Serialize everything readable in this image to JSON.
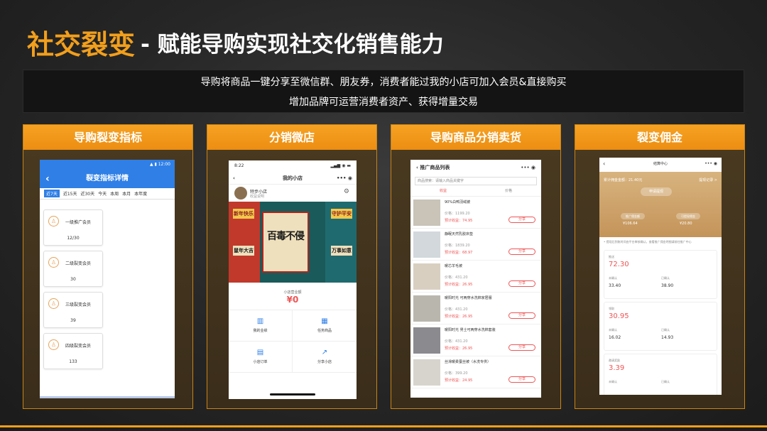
{
  "title": {
    "highlight": "社交裂变",
    "rest": "- 赋能导购实现社交化销售能力"
  },
  "description": {
    "line1": "导购将商品一键分享至微信群、朋友券，消费者能过我的小店可加入会员&直接购买",
    "line2": "增加品牌可运营消费者资产、获得增量交易"
  },
  "panels": [
    {
      "header": "导购裂变指标"
    },
    {
      "header": "分销微店"
    },
    {
      "header": "导购商品分销卖货"
    },
    {
      "header": "裂变佣金"
    }
  ],
  "phone1": {
    "status_time": "12:00",
    "page_title": "裂变指标详情",
    "tabs": [
      "近7天",
      "近15天",
      "近30天",
      "今天",
      "本周",
      "本月",
      "本年度"
    ],
    "cards": [
      {
        "label": "一级推广会员",
        "value": "12/30"
      },
      {
        "label": "二级裂变会员",
        "value": "30"
      },
      {
        "label": "三级裂变会员",
        "value": "39"
      },
      {
        "label": "四级裂变会员",
        "value": "133"
      }
    ]
  },
  "phone2": {
    "status_time": "8:22",
    "page_title": "我的小店",
    "shop_name": "特步小店",
    "shop_sub": "收益说明",
    "banner_main": "百毒不侵",
    "banner_tags": [
      "新年快乐",
      "鼠年大吉",
      "守护平安",
      "万事如意"
    ],
    "balance_label": "小店营业额",
    "balance_value": "¥0",
    "grid": [
      {
        "label": "我的业绩",
        "icon": "chart-icon"
      },
      {
        "label": "任务商品",
        "icon": "goods-icon"
      },
      {
        "label": "小店订单",
        "icon": "order-icon"
      },
      {
        "label": "分享小店",
        "icon": "share-icon"
      }
    ]
  },
  "phone3": {
    "page_title": "推广商品列表",
    "search_placeholder": "商品搜索：请输入商品关键字",
    "tabs": [
      "收益",
      "价格"
    ],
    "share_label": "分享",
    "items": [
      {
        "name": "90%白鸭羽绒被",
        "price": "价格：1199.20",
        "earn": "预计收益：74.95",
        "color": "#c9c3b8"
      },
      {
        "name": "静眠天然乳胶床垫",
        "price": "价格：1839.20",
        "earn": "预计收益：68.97",
        "color": "#d2d8dc"
      },
      {
        "name": "暖芯羊毛被",
        "price": "价格：431.20",
        "earn": "预计收益：26.95",
        "color": "#d9cfc0"
      },
      {
        "name": "暖阳时光 可两穿水洗棉家居服",
        "price": "价格：431.20",
        "earn": "预计收益：26.95",
        "color": "#b9b6ae"
      },
      {
        "name": "暖阳时光 男士可两穿水洗棉套装",
        "price": "价格：431.20",
        "earn": "预计收益：26.95",
        "color": "#8a8a8f"
      },
      {
        "name": "丝滑暖柔蚕丝被（水洗专供）",
        "price": "价格：399.20",
        "earn": "预计收益：24.95",
        "color": "#d6d4cc"
      }
    ]
  },
  "phone4": {
    "page_title": "结算中心",
    "total_label": "累计佣金金额：21.40元",
    "record_label": "提现记录 >",
    "withdraw_btn": "申请提现",
    "pill1": "推广佣金额",
    "pill2": "可提现佣金",
    "val1": "¥106.64",
    "val2": "¥20.80",
    "note": "• 提现后到账时间由平台审核确认，查看推广佣金明细请前往推广中心",
    "cards": [
      {
        "caption": "推送",
        "big": "72.30",
        "c1": "未确认",
        "c2": "已确认",
        "v1": "33.40",
        "v2": "38.90"
      },
      {
        "caption": "领取",
        "big": "30.95",
        "c1": "未确认",
        "c2": "已确认",
        "v1": "16.02",
        "v2": "14.93"
      },
      {
        "caption": "邀请奖励",
        "big": "3.39",
        "c1": "未确认",
        "c2": "已确认",
        "v1": "",
        "v2": ""
      }
    ]
  }
}
